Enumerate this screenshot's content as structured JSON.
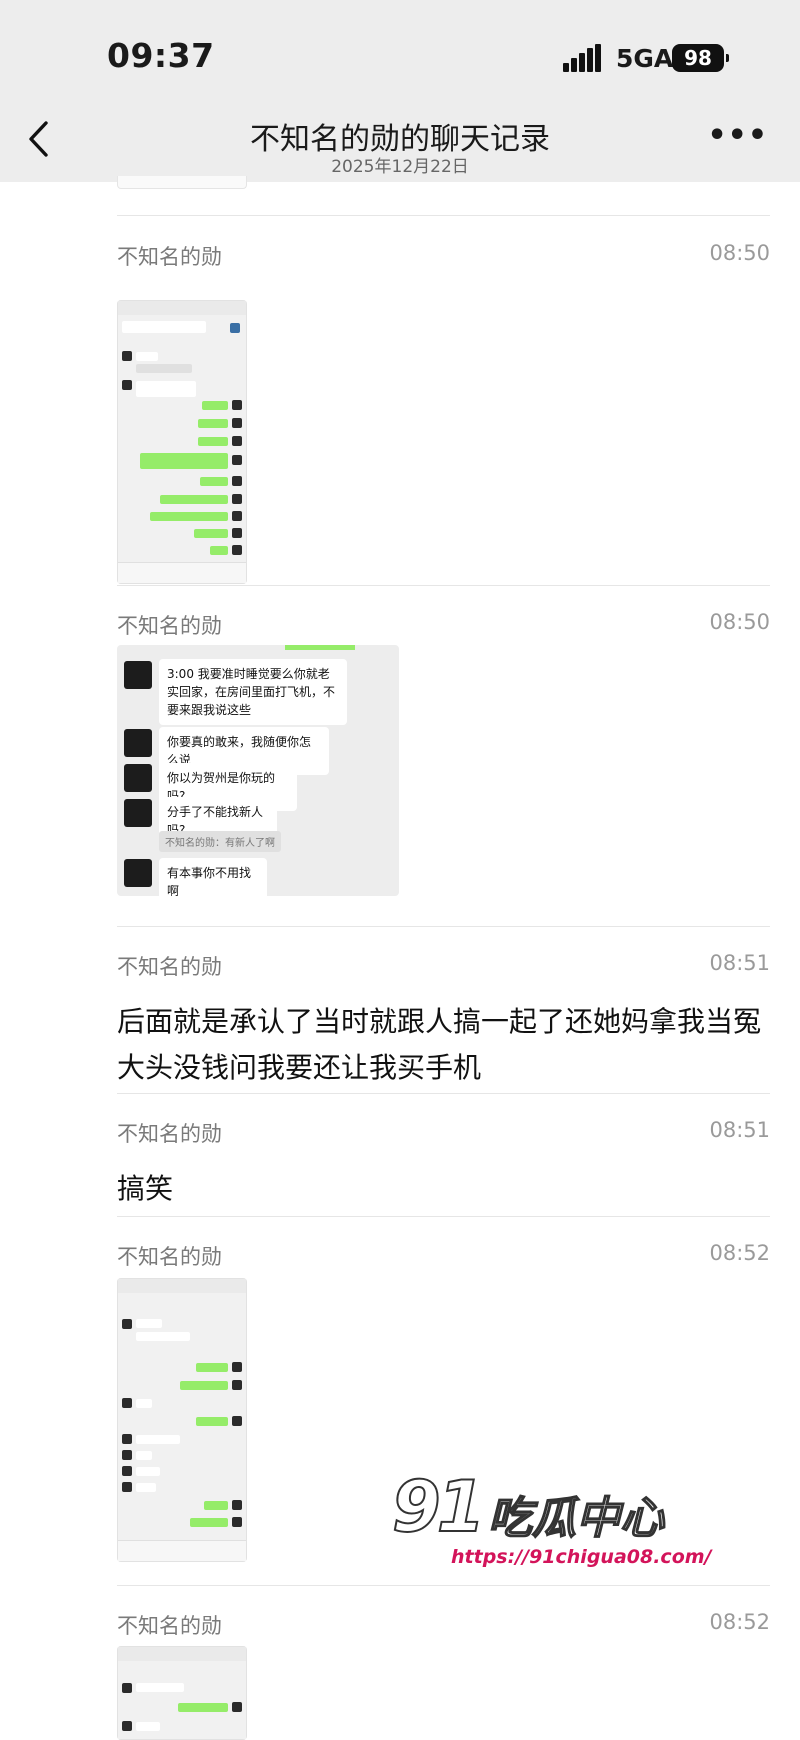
{
  "status_bar": {
    "time": "09:37",
    "network": "5GA",
    "battery": "98"
  },
  "nav": {
    "back_icon": "chevron-left-icon",
    "title": "不知名的勋的聊天记录",
    "subtitle": "2025年12月22日",
    "more_icon": "more-dots-icon"
  },
  "messages": [
    {
      "sender": "不知名的勋",
      "time": "08:50",
      "type": "image"
    },
    {
      "sender": "不知名的勋",
      "time": "08:50",
      "type": "image",
      "bubbles": [
        "3:00 我要准时睡觉要么你就老实回家，在房间里面打飞机，不要来跟我说这些",
        "你要真的敢来，我随便你怎么说",
        "你以为贺州是你玩的吗?",
        "分手了不能找新人吗?",
        "有本事你不用找啊"
      ],
      "quote": "不知名的勋：有新人了啊"
    },
    {
      "sender": "不知名的勋",
      "time": "08:51",
      "type": "text",
      "text": "后面就是承认了当时就跟人搞一起了还她妈拿我当冤大头没钱问我要还让我买手机"
    },
    {
      "sender": "不知名的勋",
      "time": "08:51",
      "type": "text",
      "text": "搞笑"
    },
    {
      "sender": "不知名的勋",
      "time": "08:52",
      "type": "image"
    },
    {
      "sender": "不知名的勋",
      "time": "08:52",
      "type": "image"
    }
  ],
  "watermark": {
    "logo": "91",
    "name": "吃瓜中心",
    "url": "https://91chigua08.com/"
  },
  "colors": {
    "bar_bg": "#ededed",
    "wechat_green": "#95ec69",
    "watermark_url": "#d3145a"
  }
}
